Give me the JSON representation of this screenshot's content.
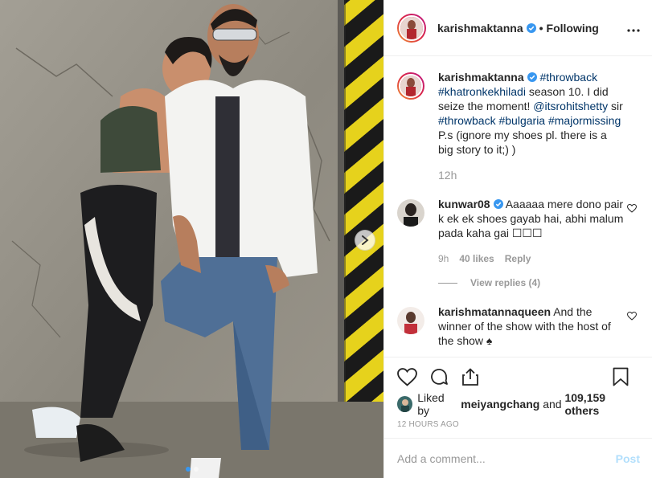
{
  "header": {
    "username": "karishmaktanna",
    "separator": "•",
    "follow_status": "Following"
  },
  "caption": {
    "username": "karishmaktanna",
    "parts": [
      {
        "text": "#throwback",
        "tag": true
      },
      {
        "text": " ",
        "tag": false
      },
      {
        "text": "#khatronkekhiladi",
        "tag": true
      },
      {
        "text": " season 10. I did seize the moment! ",
        "tag": false
      },
      {
        "text": "@itsrohitshetty",
        "tag": true
      },
      {
        "text": " sir ",
        "tag": false
      },
      {
        "text": "#throwback",
        "tag": true
      },
      {
        "text": " ",
        "tag": false
      },
      {
        "text": "#bulgaria",
        "tag": true
      },
      {
        "text": " ",
        "tag": false
      },
      {
        "text": "#majormissing",
        "tag": true
      },
      {
        "text": " P.s (ignore my shoes pl. there is a big story to it;) )",
        "tag": false
      }
    ],
    "time": "12h"
  },
  "comments": [
    {
      "username": "kunwar08",
      "verified": true,
      "text": "Aaaaaa mere dono pair k ek ek shoes gayab hai, abhi malum pada kaha gai ☐☐☐",
      "time": "9h",
      "likes": "40 likes",
      "reply_label": "Reply",
      "view_replies": "View replies (4)"
    },
    {
      "username": "karishmatannaqueen",
      "verified": false,
      "text": "And the winner of the show with the host of the show ♠"
    }
  ],
  "actions": {
    "liked_by_prefix": "Liked by",
    "liked_by_user": "meiyangchang",
    "liked_by_and": "and",
    "liked_by_count": "109,159 others",
    "timeago": "12 HOURS AGO"
  },
  "add_comment": {
    "placeholder": "Add a comment...",
    "post_label": "Post"
  },
  "carousel": {
    "slides": 2,
    "active": 1
  },
  "colors": {
    "link": "#003569",
    "muted": "#999999",
    "verified": "#3897f0",
    "post_disabled": "#b2dffc",
    "border": "#efefef"
  },
  "icons": [
    "verified-badge-icon",
    "more-options-icon",
    "heart-icon",
    "comment-icon",
    "share-icon",
    "bookmark-icon",
    "chevron-right-icon"
  ]
}
